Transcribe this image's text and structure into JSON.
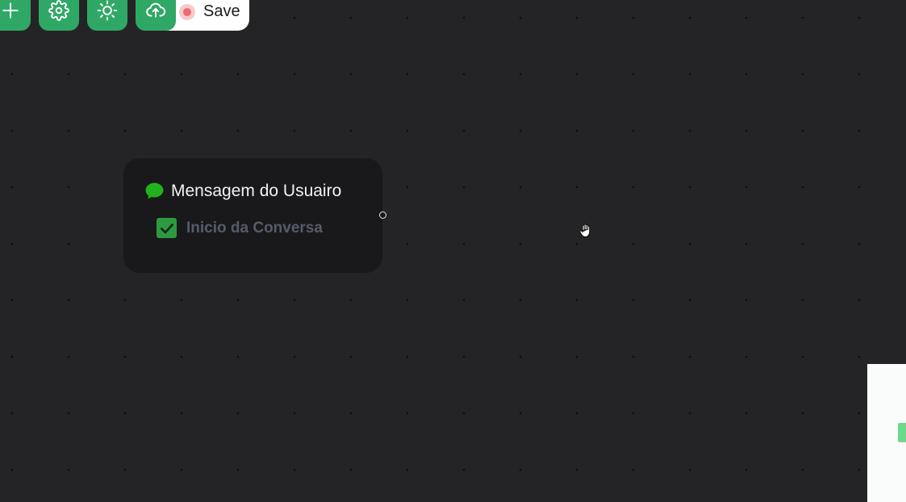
{
  "toolbar": {
    "buttons": [
      {
        "id": "add",
        "icon": "plus-icon"
      },
      {
        "id": "settings",
        "icon": "gear-icon"
      },
      {
        "id": "theme",
        "icon": "sun-icon"
      },
      {
        "id": "upload",
        "icon": "cloud-upload-icon"
      }
    ],
    "save_label": "Save",
    "accent_color": "#2fa866",
    "save_status_color": "#ef6b72"
  },
  "node": {
    "icon": "chat-bubble-icon",
    "title": "Mensagem do Usuairo",
    "checkbox_label": "Inicio da Conversa",
    "checkbox_checked": true,
    "icon_color": "#22b21e"
  },
  "cursor": {
    "icon": "grab-hand-icon"
  },
  "canvas": {
    "background": "#242426"
  }
}
